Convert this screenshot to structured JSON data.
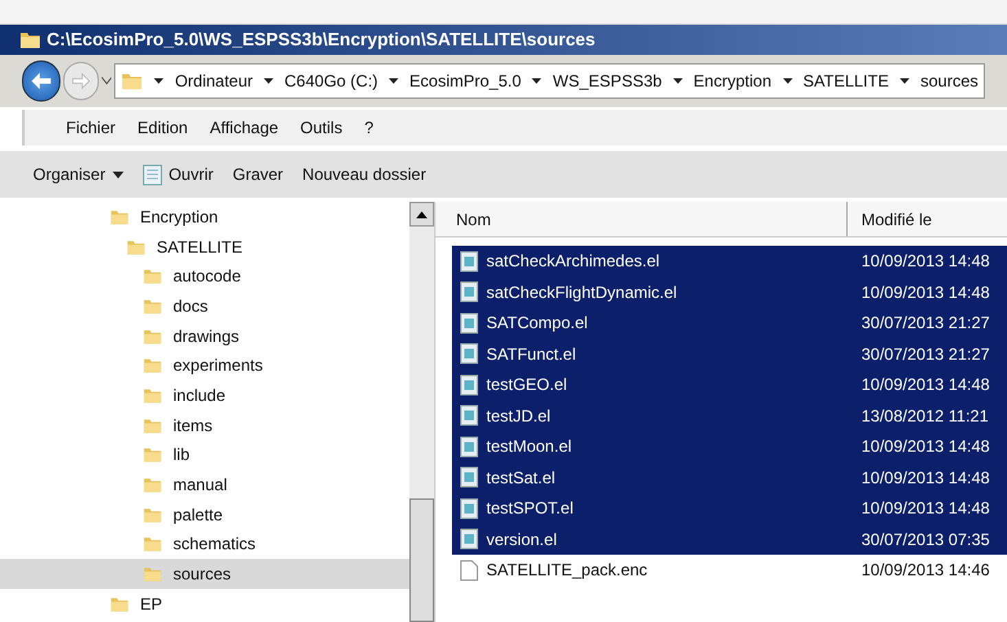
{
  "window": {
    "title": "C:\\EcosimPro_5.0\\WS_ESPSS3b\\Encryption\\SATELLITE\\sources"
  },
  "address_bar": {
    "segments": [
      "Ordinateur",
      "C640Go (C:)",
      "EcosimPro_5.0",
      "WS_ESPSS3b",
      "Encryption",
      "SATELLITE",
      "sources"
    ]
  },
  "menu": [
    "Fichier",
    "Edition",
    "Affichage",
    "Outils",
    "?"
  ],
  "toolbar": [
    {
      "label": "Organiser",
      "kind": "dropdown"
    },
    {
      "label": "Ouvrir",
      "kind": "icon"
    },
    {
      "label": "Graver",
      "kind": "plain"
    },
    {
      "label": "Nouveau dossier",
      "kind": "plain"
    }
  ],
  "tree": [
    {
      "label": "Encryption",
      "selected": false,
      "children": [
        {
          "label": "SATELLITE",
          "selected": false,
          "children": [
            {
              "label": "autocode",
              "selected": false
            },
            {
              "label": "docs",
              "selected": false
            },
            {
              "label": "drawings",
              "selected": false
            },
            {
              "label": "experiments",
              "selected": false
            },
            {
              "label": "include",
              "selected": false
            },
            {
              "label": "items",
              "selected": false
            },
            {
              "label": "lib",
              "selected": false
            },
            {
              "label": "manual",
              "selected": false
            },
            {
              "label": "palette",
              "selected": false
            },
            {
              "label": "schematics",
              "selected": false
            },
            {
              "label": "sources",
              "selected": true
            }
          ]
        }
      ]
    },
    {
      "label": "EP",
      "selected": false
    }
  ],
  "table": {
    "columns": [
      "Nom",
      "Modifié le"
    ],
    "rows": [
      {
        "name": "satCheckArchimedes.el",
        "modified": "10/09/2013 14:48",
        "kind": "source",
        "selected": true
      },
      {
        "name": "satCheckFlightDynamic.el",
        "modified": "10/09/2013 14:48",
        "kind": "source",
        "selected": true
      },
      {
        "name": "SATCompo.el",
        "modified": "30/07/2013 21:27",
        "kind": "source",
        "selected": true
      },
      {
        "name": "SATFunct.el",
        "modified": "30/07/2013 21:27",
        "kind": "source",
        "selected": true
      },
      {
        "name": "testGEO.el",
        "modified": "10/09/2013 14:48",
        "kind": "source",
        "selected": true
      },
      {
        "name": "testJD.el",
        "modified": "13/08/2012 11:21",
        "kind": "source",
        "selected": true
      },
      {
        "name": "testMoon.el",
        "modified": "10/09/2013 14:48",
        "kind": "source",
        "selected": true
      },
      {
        "name": "testSat.el",
        "modified": "10/09/2013 14:48",
        "kind": "source",
        "selected": true
      },
      {
        "name": "testSPOT.el",
        "modified": "10/09/2013 14:48",
        "kind": "source",
        "selected": true
      },
      {
        "name": "version.el",
        "modified": "30/07/2013 07:35",
        "kind": "source",
        "selected": true
      },
      {
        "name": "SATELLITE_pack.enc",
        "modified": "10/09/2013 14:46",
        "kind": "plain",
        "selected": false
      }
    ]
  }
}
